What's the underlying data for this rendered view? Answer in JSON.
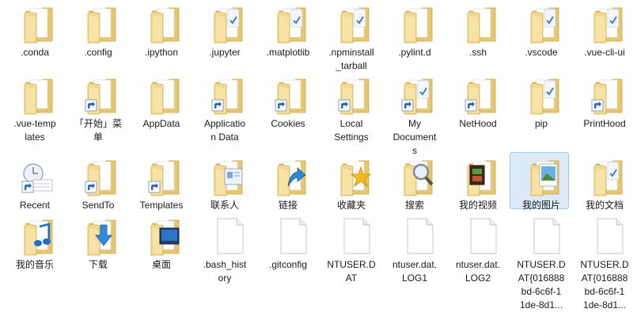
{
  "items": [
    {
      "label": ".conda",
      "icon": "folder",
      "overlay": ""
    },
    {
      "label": ".config",
      "icon": "folder",
      "overlay": ""
    },
    {
      "label": ".ipython",
      "icon": "folder",
      "overlay": ""
    },
    {
      "label": ".jupyter",
      "icon": "folder",
      "overlay": "doc"
    },
    {
      "label": ".matplotlib",
      "icon": "folder",
      "overlay": "doc"
    },
    {
      "label": ".npminstall\n_tarball",
      "icon": "folder",
      "overlay": "doc"
    },
    {
      "label": ".pylint.d",
      "icon": "folder",
      "overlay": ""
    },
    {
      "label": ".ssh",
      "icon": "folder",
      "overlay": ""
    },
    {
      "label": ".vscode",
      "icon": "folder",
      "overlay": "doc"
    },
    {
      "label": ".vue-cli-ui",
      "icon": "folder",
      "overlay": "doc"
    },
    {
      "label": ".vue-temp\nlates",
      "icon": "folder",
      "overlay": ""
    },
    {
      "label": "「开始」菜\n单",
      "icon": "folder-shortcut",
      "overlay": ""
    },
    {
      "label": "AppData",
      "icon": "folder",
      "overlay": ""
    },
    {
      "label": "Applicatio\nn Data",
      "icon": "folder-shortcut",
      "overlay": ""
    },
    {
      "label": "Cookies",
      "icon": "folder-shortcut",
      "overlay": ""
    },
    {
      "label": "Local\nSettings",
      "icon": "folder-shortcut",
      "overlay": ""
    },
    {
      "label": "My\nDocument\ns",
      "icon": "folder-shortcut",
      "overlay": "doc"
    },
    {
      "label": "NetHood",
      "icon": "folder-shortcut",
      "overlay": ""
    },
    {
      "label": "pip",
      "icon": "folder",
      "overlay": "doc"
    },
    {
      "label": "PrintHood",
      "icon": "folder-shortcut",
      "overlay": ""
    },
    {
      "label": "Recent",
      "icon": "recent-shortcut",
      "overlay": ""
    },
    {
      "label": "SendTo",
      "icon": "folder-shortcut",
      "overlay": ""
    },
    {
      "label": "Templates",
      "icon": "folder-shortcut",
      "overlay": ""
    },
    {
      "label": "联系人",
      "icon": "folder",
      "overlay": "contacts"
    },
    {
      "label": "链接",
      "icon": "folder",
      "overlay": "link-arrow"
    },
    {
      "label": "收藏夹",
      "icon": "folder",
      "overlay": "star"
    },
    {
      "label": "搜索",
      "icon": "folder",
      "overlay": "magnifier"
    },
    {
      "label": "我的视频",
      "icon": "folder",
      "overlay": "film"
    },
    {
      "label": "我的图片",
      "icon": "folder",
      "overlay": "picture",
      "selected": true
    },
    {
      "label": "我的文档",
      "icon": "folder",
      "overlay": "doc"
    },
    {
      "label": "我的音乐",
      "icon": "folder",
      "overlay": "music"
    },
    {
      "label": "下载",
      "icon": "folder",
      "overlay": "download"
    },
    {
      "label": "桌面",
      "icon": "folder",
      "overlay": "desktop"
    },
    {
      "label": ".bash_hist\nory",
      "icon": "file",
      "overlay": ""
    },
    {
      "label": ".gitconfig",
      "icon": "file",
      "overlay": ""
    },
    {
      "label": "NTUSER.D\nAT",
      "icon": "file",
      "overlay": ""
    },
    {
      "label": "ntuser.dat.\nLOG1",
      "icon": "file",
      "overlay": ""
    },
    {
      "label": "ntuser.dat.\nLOG2",
      "icon": "file",
      "overlay": ""
    },
    {
      "label": "NTUSER.D\nAT{016888\nbd-6c6f-1\n1de-8d1...",
      "icon": "file",
      "overlay": ""
    },
    {
      "label": "NTUSER.D\nAT{016888\nbd-6c6f-1\n1de-8d1...",
      "icon": "file",
      "overlay": ""
    }
  ]
}
